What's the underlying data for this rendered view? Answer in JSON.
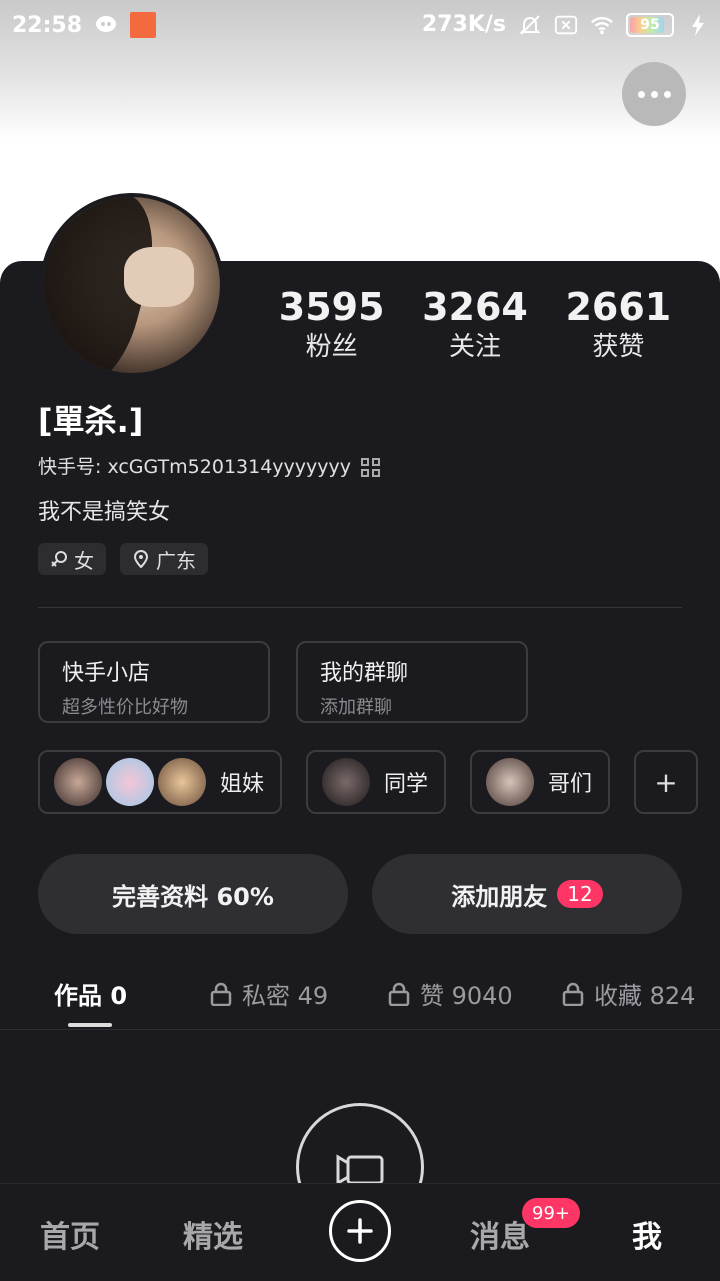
{
  "status_bar": {
    "time": "22:58",
    "network_speed": "273K/s",
    "battery_level": "95",
    "icons": [
      "chat-bubble-icon",
      "orange-app-icon",
      "mute-icon",
      "sim-off-icon",
      "wifi-icon",
      "battery-icon",
      "charging-icon"
    ]
  },
  "profile": {
    "name": "[單杀.]",
    "kuaishou_id": "快手号: xcGGTm5201314yyyyyyy",
    "bio": "我不是搞笑女",
    "tags": [
      {
        "label": "女",
        "icon": "female-icon"
      },
      {
        "label": "广东",
        "icon": "location-pin-icon"
      }
    ],
    "stats": [
      {
        "value": "3595",
        "label": "粉丝"
      },
      {
        "value": "3264",
        "label": "关注"
      },
      {
        "value": "2661",
        "label": "获赞"
      }
    ]
  },
  "quick_links": [
    {
      "title": "快手小店",
      "subtitle": "超多性价比好物"
    },
    {
      "title": "我的群聊",
      "subtitle": "添加群聊"
    }
  ],
  "groups": [
    {
      "label": "姐妹"
    },
    {
      "label": "同学"
    },
    {
      "label": "哥们"
    }
  ],
  "add_group_symbol": "+",
  "buttons": {
    "complete_profile": "完善资料 60%",
    "add_friends": "添加朋友",
    "add_friends_badge": "12"
  },
  "tabs": [
    {
      "label": "作品 0",
      "active": true
    },
    {
      "label": "私密 49",
      "locked": true
    },
    {
      "label": "赞 9040",
      "locked": true
    },
    {
      "label": "收藏 824",
      "locked": true
    }
  ],
  "bottom_nav": {
    "home": "首页",
    "featured": "精选",
    "messages": "消息",
    "messages_badge": "99+",
    "me": "我"
  },
  "colors": {
    "background_dark": "#1b1b1f",
    "badge_pink": "#fe3666"
  }
}
